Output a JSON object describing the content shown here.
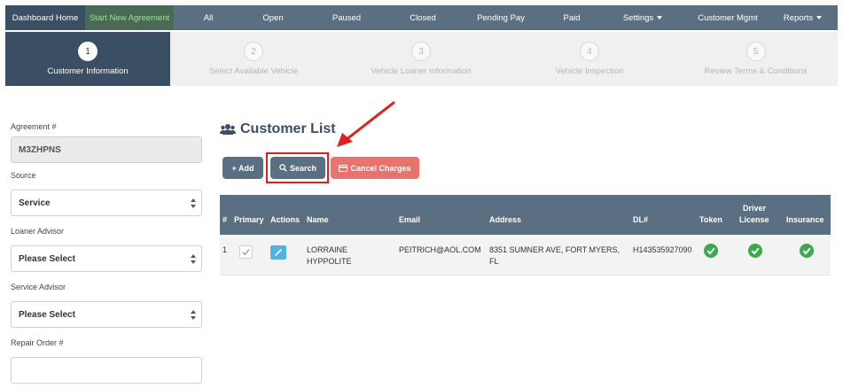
{
  "nav": {
    "items": [
      {
        "label": "Dashboard Home"
      },
      {
        "label": "Start New Agreement"
      },
      {
        "label": "All"
      },
      {
        "label": "Open"
      },
      {
        "label": "Paused"
      },
      {
        "label": "Closed"
      },
      {
        "label": "Pending Pay"
      },
      {
        "label": "Paid"
      },
      {
        "label": "Settings"
      },
      {
        "label": "Customer Mgmt"
      },
      {
        "label": "Reports"
      }
    ]
  },
  "steps": [
    {
      "number": "1",
      "label": "Customer Information"
    },
    {
      "number": "2",
      "label": "Select Available Vehicle"
    },
    {
      "number": "3",
      "label": "Vehicle Loaner Information"
    },
    {
      "number": "4",
      "label": "Vehicle Inspection"
    },
    {
      "number": "5",
      "label": "Review Terms & Conditions"
    }
  ],
  "form": {
    "agreement_label": "Agreement #",
    "agreement_value": "M3ZHPNS",
    "source_label": "Source",
    "source_value": "Service",
    "loaner_advisor_label": "Loaner Advisor",
    "loaner_advisor_value": "Please Select",
    "service_advisor_label": "Service Advisor",
    "service_advisor_value": "Please Select",
    "repair_order_label": "Repair Order #",
    "repair_order_value": ""
  },
  "customer_list": {
    "title": "Customer List",
    "add_label": "+ Add",
    "search_label": "Search",
    "cancel_label": "Cancel Charges",
    "headers": {
      "index": "#",
      "primary": "Primary",
      "actions": "Actions",
      "name": "Name",
      "email": "Email",
      "address": "Address",
      "dl": "DL#",
      "token": "Token",
      "driver_license_1": "Driver",
      "driver_license_2": "License",
      "insurance": "Insurance"
    },
    "rows": [
      {
        "index": "1",
        "name_line1": "LORRAINE",
        "name_line2": "HYPPOLITE",
        "email": "PEITRICH@AOL.COM",
        "address_line1": "8351 SUMNER AVE, FORT MYERS,",
        "address_line2": "FL",
        "dl": "H143535927090"
      }
    ]
  },
  "colors": {
    "nav_bg": "#5a6f82",
    "nav_active": "#3a4f63",
    "start_new_text": "#9fe09a",
    "cancel_button": "#e8736c",
    "check_green": "#3aa94e",
    "highlight_red": "#e02020"
  }
}
